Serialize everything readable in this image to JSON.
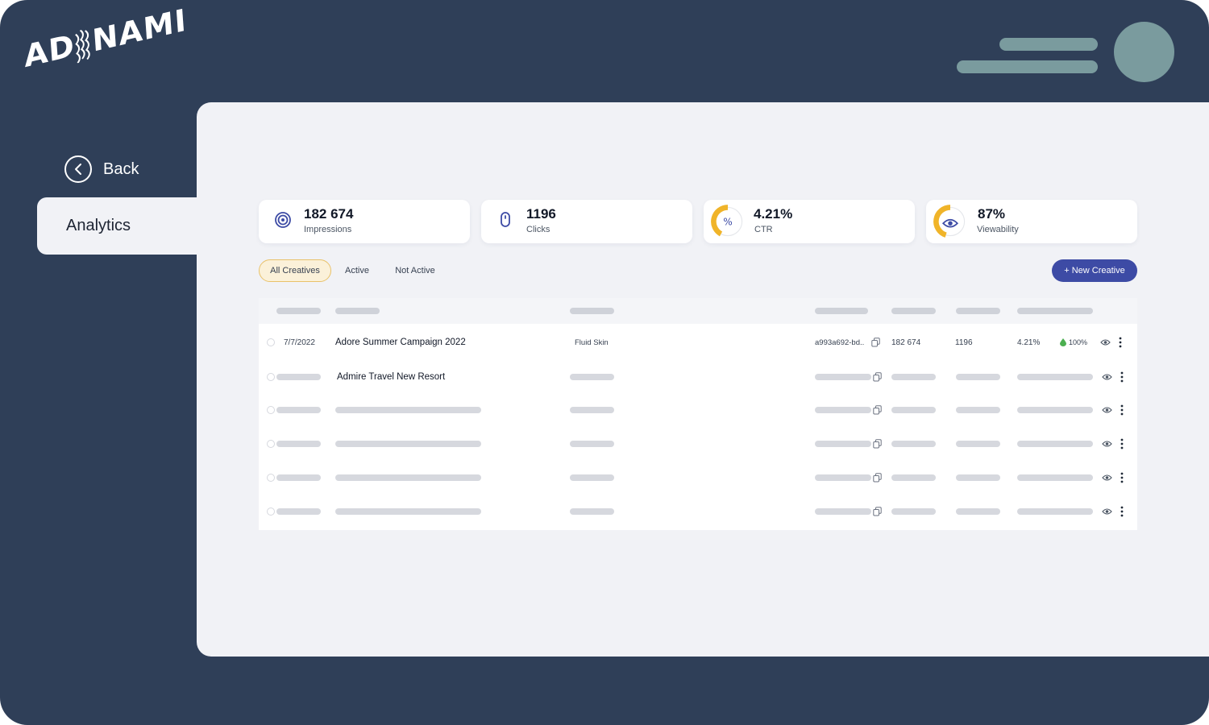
{
  "brand": {
    "logo_text_left": "AD",
    "logo_text_right": "NAMI",
    "accent": "#3d4ba5",
    "gauge": "#f0b429"
  },
  "sidebar": {
    "back_label": "Back",
    "active_item": "Analytics"
  },
  "stats": [
    {
      "value": "182 674",
      "label": "Impressions",
      "icon": "target-icon"
    },
    {
      "value": "1196",
      "label": "Clicks",
      "icon": "mouse-icon"
    },
    {
      "value": "4.21%",
      "label": "CTR",
      "icon": "percent-gauge-icon",
      "level": 0.42
    },
    {
      "value": "87%",
      "label": "Viewability",
      "icon": "eye-gauge-icon",
      "level": 0.45
    }
  ],
  "filters": {
    "all": "All Creatives",
    "active": "Active",
    "inactive": "Not Active"
  },
  "actions": {
    "new_creative": "+ New Creative"
  },
  "table": {
    "rows": [
      {
        "date": "7/7/2022",
        "name": "Adore Summer Campaign 2022",
        "format": "Fluid Skin",
        "id": "a993a692-bd..",
        "impressions": "182 674",
        "clicks": "1196",
        "ctr": "4.21%",
        "viewability": "100%"
      },
      {
        "name": "Admire Travel New Resort"
      }
    ]
  }
}
